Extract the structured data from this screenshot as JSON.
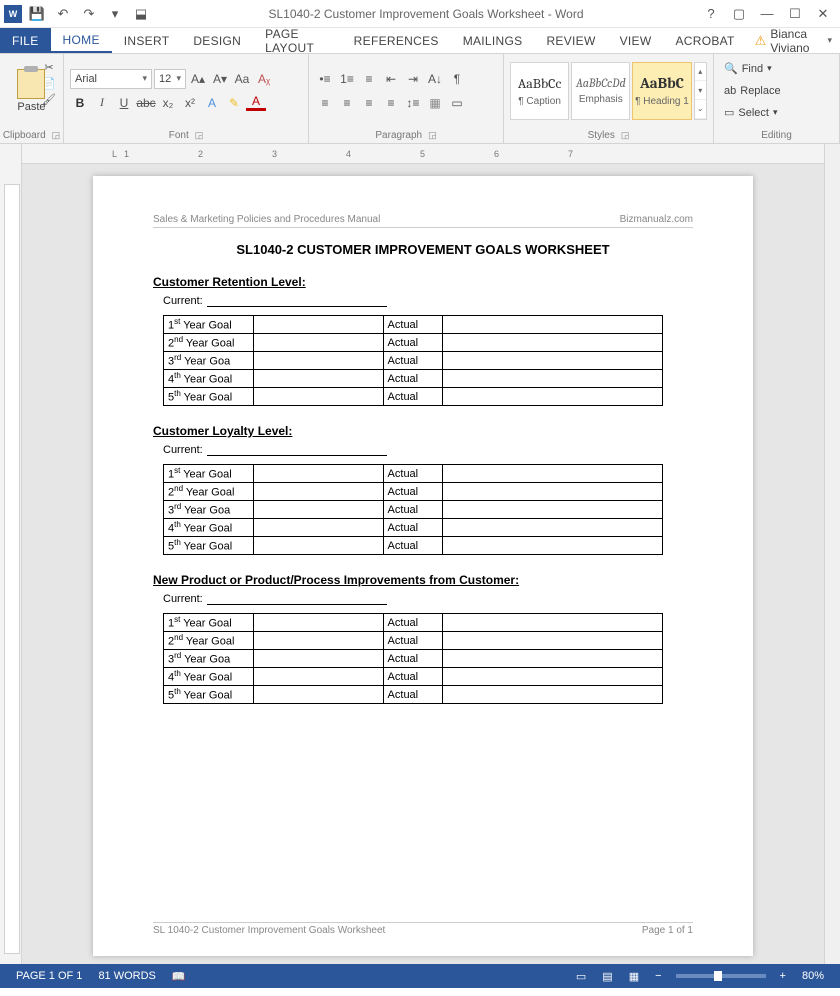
{
  "titlebar": {
    "appTitle": "SL1040-2 Customer Improvement Goals Worksheet - Word"
  },
  "tabs": {
    "file": "FILE",
    "home": "HOME",
    "insert": "INSERT",
    "design": "DESIGN",
    "pageLayout": "PAGE LAYOUT",
    "references": "REFERENCES",
    "mailings": "MAILINGS",
    "review": "REVIEW",
    "view": "VIEW",
    "acrobat": "ACROBAT"
  },
  "user": {
    "name": "Bianca Viviano"
  },
  "ribbon": {
    "clipboard": {
      "paste": "Paste",
      "label": "Clipboard"
    },
    "font": {
      "name": "Arial",
      "size": "12",
      "label": "Font"
    },
    "paragraph": {
      "label": "Paragraph"
    },
    "styles": {
      "label": "Styles",
      "items": [
        {
          "preview": "AaBbCc",
          "name": "¶ Caption"
        },
        {
          "preview": "AaBbCcDd",
          "name": "Emphasis"
        },
        {
          "preview": "AaBbC",
          "name": "¶ Heading 1"
        }
      ]
    },
    "editing": {
      "label": "Editing",
      "find": "Find",
      "replace": "Replace",
      "select": "Select"
    }
  },
  "ruler": {
    "ticks": [
      "1",
      "2",
      "3",
      "4",
      "5",
      "6",
      "7"
    ]
  },
  "document": {
    "headerLeft": "Sales & Marketing Policies and Procedures Manual",
    "headerRight": "Bizmanualz.com",
    "title": "SL1040-2 CUSTOMER IMPROVEMENT GOALS WORKSHEET",
    "currentLabel": "Current:",
    "actualLabel": "Actual",
    "sections": [
      {
        "heading": "Customer Retention Level:"
      },
      {
        "heading": "Customer Loyalty Level:"
      },
      {
        "heading": "New Product or Product/Process Improvements from Customer:"
      }
    ],
    "goalRows": [
      {
        "ord": "1",
        "sup": "st",
        "tail": " Year Goal"
      },
      {
        "ord": "2",
        "sup": "nd",
        "tail": " Year Goal"
      },
      {
        "ord": "3",
        "sup": "rd",
        "tail": " Year Goa"
      },
      {
        "ord": "4",
        "sup": "th",
        "tail": " Year Goal"
      },
      {
        "ord": "5",
        "sup": "th",
        "tail": " Year Goal"
      }
    ],
    "footerLeft": "SL 1040-2 Customer Improvement Goals Worksheet",
    "footerRight": "Page 1 of 1"
  },
  "status": {
    "page": "PAGE 1 OF 1",
    "words": "81 WORDS",
    "zoomMinus": "−",
    "zoomPlus": "+",
    "zoom": "80%"
  }
}
